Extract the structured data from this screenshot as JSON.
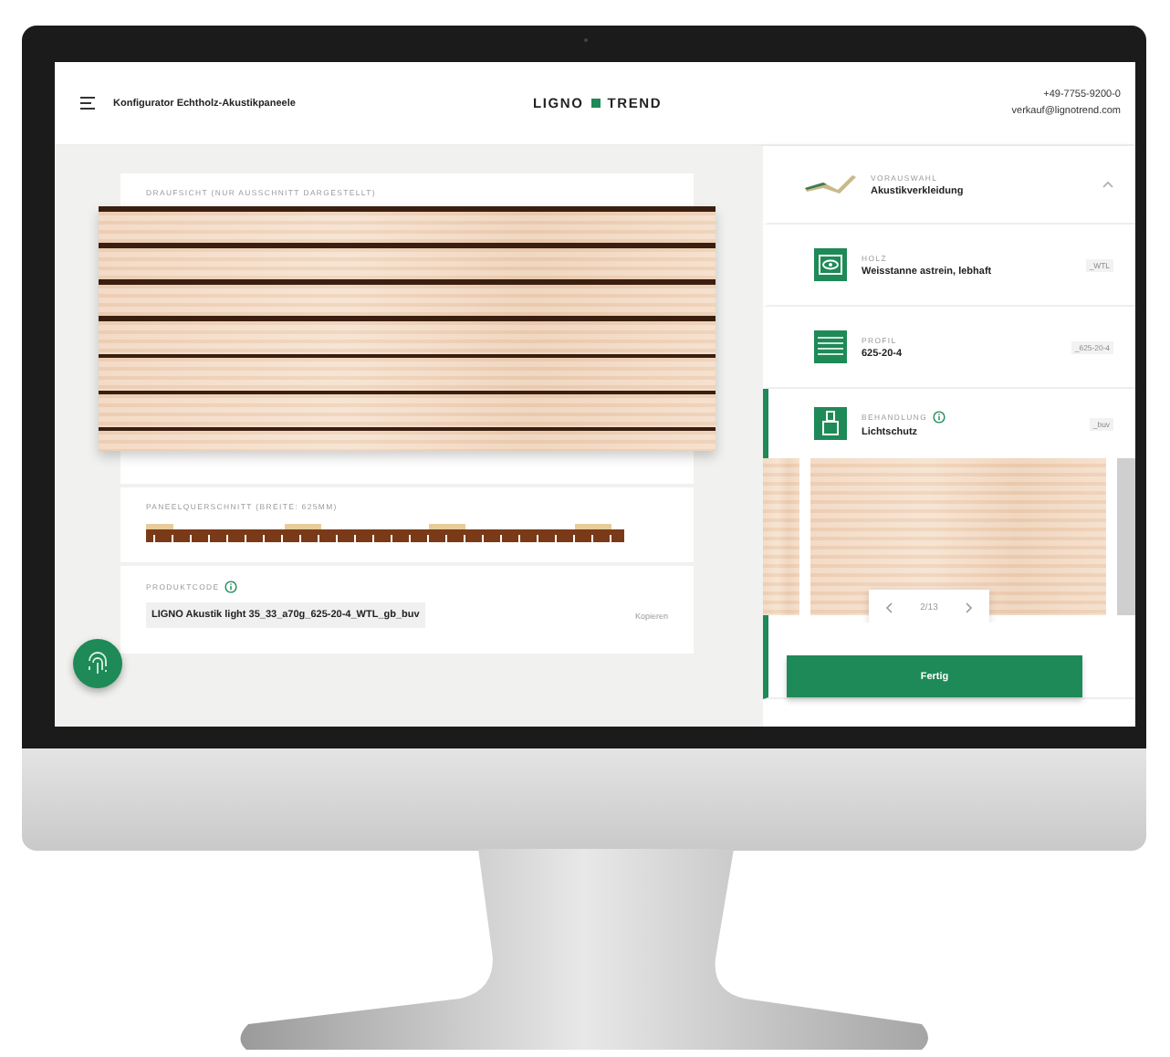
{
  "header": {
    "title": "Konfigurator Echtholz-Akustikpaneele",
    "logo_left": "LIGNO",
    "logo_right": "TREND",
    "phone": "+49-7755-9200-0",
    "email": "verkauf@lignotrend.com"
  },
  "preview": {
    "top_view_label": "DRAUFSICHT (NUR AUSSCHNITT DARGESTELLT)",
    "cross_section_label": "PANEELQUERSCHNITT (BREITE: 625MM)",
    "product_code_label": "PRODUKTCODE",
    "product_code_info": true,
    "product_code": "LIGNO Akustik light 35_33_a70g_625-20-4_WTL_gb_buv",
    "copy_link": "Kopieren"
  },
  "steps": [
    {
      "kind": "preselect",
      "label": "VORAUSWAHL",
      "value": "Akustikverkleidung",
      "expanded": true,
      "info": false,
      "selected": false
    },
    {
      "kind": "wood",
      "label": "HOLZ",
      "value": "Weisstanne astrein, lebhaft",
      "code": "_WTL",
      "info": false,
      "selected": false
    },
    {
      "kind": "profile",
      "label": "PROFIL",
      "value": "625-20-4",
      "code": "_625-20-4",
      "info": false,
      "selected": false
    },
    {
      "kind": "treatment",
      "label": "BEHANDLUNG",
      "value": "Lichtschutz",
      "code": "_buv",
      "info": true,
      "selected": true,
      "carousel_page": "2/13"
    }
  ],
  "done_button": "Fertig"
}
